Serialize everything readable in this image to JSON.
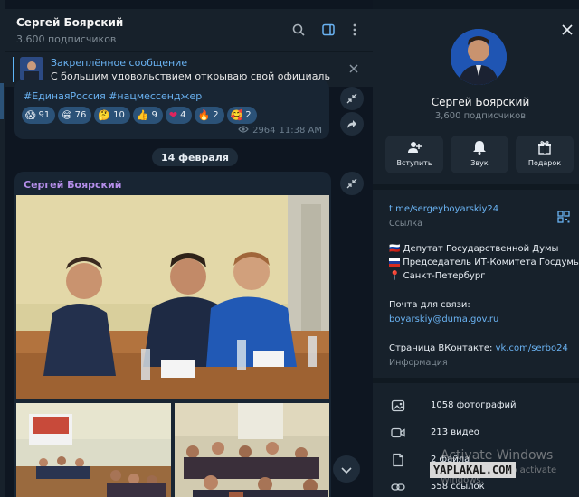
{
  "chat": {
    "title": "Сергей Боярский",
    "subscribers": "3,600 подписчиков",
    "pinned_label": "Закреплённое сообщение",
    "pinned_text": "С большим удовольствием открываю свой официальный ..."
  },
  "message1": {
    "hashtags": "#ЕдинаяРоссия #нацмессенджер",
    "reactions": [
      {
        "emoji": "😱",
        "count": "91"
      },
      {
        "emoji": "😁",
        "count": "76"
      },
      {
        "emoji": "🤔",
        "count": "10"
      },
      {
        "emoji": "👍",
        "count": "9"
      },
      {
        "emoji": "❤",
        "count": "4"
      },
      {
        "emoji": "🔥",
        "count": "2"
      },
      {
        "emoji": "🥰",
        "count": "2"
      }
    ],
    "views": "2964",
    "time": "11:38 AM"
  },
  "date_chip": "14 февраля",
  "message2": {
    "author": "Сергей Боярский"
  },
  "profile": {
    "name": "Сергей Боярский",
    "subscribers": "3,600 подписчиков",
    "buttons": [
      {
        "label": "Вступить",
        "icon": "add-user-icon"
      },
      {
        "label": "Звук",
        "icon": "bell-icon"
      },
      {
        "label": "Подарок",
        "icon": "gift-icon"
      }
    ],
    "link": "t.me/sergeyboyarskiy24",
    "link_caption": "Ссылка",
    "bio": [
      {
        "flag": "🇷🇺",
        "text": "Депутат Государственной Думы"
      },
      {
        "flag": "",
        "text": "Председатель ИТ-Комитета Госдумы"
      },
      {
        "flag": "📍",
        "text": "Санкт-Петербург"
      }
    ],
    "email_label": "Почта для связи:",
    "email": "boyarskiy@duma.gov.ru",
    "vk_label": "Страница ВКонтакте:",
    "vk_link": "vk.com/serbo24",
    "info_caption": "Информация",
    "media": [
      {
        "icon": "photo-icon",
        "text": "1058 фотографий"
      },
      {
        "icon": "video-icon",
        "text": "213 видео"
      },
      {
        "icon": "file-icon",
        "text": "2 файла"
      },
      {
        "icon": "link-icon",
        "text": "558 ссылок"
      }
    ]
  },
  "watermark": {
    "line1": "Activate Windows",
    "line2": "Go to Settings to activate Windows.",
    "badge": "YAPLAKAL.COM"
  },
  "colors": {
    "background": "#0e1621",
    "panel": "#17212b",
    "accent": "#6ab3f3",
    "author": "#b58eea",
    "reaction": "#2b5278"
  }
}
